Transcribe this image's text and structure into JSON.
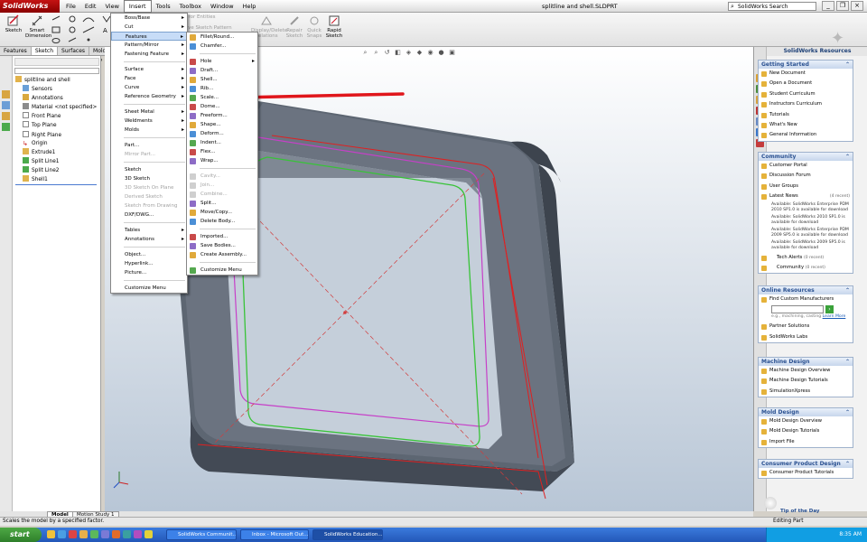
{
  "app": {
    "logo": "SolidWorks",
    "doc_title": "splitline and shell.SLDPRT",
    "search_placeholder": "SolidWorks Search"
  },
  "menubar": {
    "items": [
      "File",
      "Edit",
      "View",
      "Insert",
      "Tools",
      "Toolbox",
      "Window",
      "Help"
    ]
  },
  "command_manager": {
    "sketch": "Sketch",
    "smart_dimension": "Smart\nDimension",
    "mirror_entities": "Mirror Entities",
    "move_entities": "Move Sketch Pattern",
    "display_delete": "Display/Delete\nRelations",
    "repair_sketch": "Repair\nSketch",
    "quick_snaps": "Quick\nSnaps",
    "rapid_sketch": "Rapid\nSketch"
  },
  "left_tabs": [
    "Features",
    "Sketch",
    "Surfaces",
    "Mold Too"
  ],
  "tree": {
    "root": "splitline and shell",
    "items": [
      "Sensors",
      "Annotations",
      "Material <not specified>",
      "Front Plane",
      "Top Plane",
      "Right Plane",
      "Origin",
      "Extrude1",
      "Split Line1",
      "Split Line2",
      "Shell1"
    ]
  },
  "insert_menu": {
    "items": [
      {
        "label": "Boss/Base",
        "sub": true
      },
      {
        "label": "Cut",
        "sub": true
      },
      {
        "label": "Features",
        "sub": true,
        "hi": true
      },
      {
        "label": "Pattern/Mirror",
        "sub": true
      },
      {
        "label": "Fastening Feature",
        "sub": true
      },
      {
        "sep": true
      },
      {
        "label": "Surface",
        "sub": true
      },
      {
        "label": "Face",
        "sub": true
      },
      {
        "label": "Curve",
        "sub": true
      },
      {
        "label": "Reference Geometry",
        "sub": true
      },
      {
        "sep": true
      },
      {
        "label": "Sheet Metal",
        "sub": true
      },
      {
        "label": "Weldments",
        "sub": true
      },
      {
        "label": "Molds",
        "sub": true
      },
      {
        "sep": true
      },
      {
        "label": "Part..."
      },
      {
        "label": "Mirror Part...",
        "dis": true
      },
      {
        "sep": true
      },
      {
        "label": "Sketch"
      },
      {
        "label": "3D Sketch"
      },
      {
        "label": "3D Sketch On Plane",
        "dis": true
      },
      {
        "label": "Derived Sketch",
        "dis": true
      },
      {
        "label": "Sketch From Drawing",
        "dis": true
      },
      {
        "label": "DXF/DWG..."
      },
      {
        "sep": true
      },
      {
        "label": "Tables",
        "sub": true
      },
      {
        "label": "Annotations",
        "sub": true
      },
      {
        "sep": true
      },
      {
        "label": "Object..."
      },
      {
        "label": "Hyperlink..."
      },
      {
        "label": "Picture..."
      },
      {
        "sep": true
      },
      {
        "label": "Customize Menu"
      }
    ]
  },
  "features_menu": {
    "items": [
      {
        "label": "Fillet/Round..."
      },
      {
        "label": "Chamfer..."
      },
      {
        "sep": true
      },
      {
        "label": "Hole",
        "sub": true
      },
      {
        "label": "Draft..."
      },
      {
        "label": "Shell..."
      },
      {
        "label": "Rib..."
      },
      {
        "label": "Scale..."
      },
      {
        "label": "Dome..."
      },
      {
        "label": "Freeform..."
      },
      {
        "label": "Shape..."
      },
      {
        "label": "Deform..."
      },
      {
        "label": "Indent..."
      },
      {
        "label": "Flex..."
      },
      {
        "label": "Wrap..."
      },
      {
        "sep": true
      },
      {
        "label": "Cavity...",
        "dis": true
      },
      {
        "label": "Join...",
        "dis": true
      },
      {
        "label": "Combine...",
        "dis": true
      },
      {
        "label": "Split..."
      },
      {
        "label": "Move/Copy..."
      },
      {
        "label": "Delete Body..."
      },
      {
        "sep": true
      },
      {
        "label": "Imported..."
      },
      {
        "label": "Save Bodies..."
      },
      {
        "label": "Create Assembly..."
      },
      {
        "sep": true
      },
      {
        "label": "Customize Menu"
      }
    ]
  },
  "task_pane": {
    "header": "SolidWorks Resources",
    "getting_started": {
      "title": "Getting Started",
      "items": [
        "New Document",
        "Open a Document",
        "Student Curriculum",
        "Instructors Curriculum",
        "Tutorials",
        "What's New",
        "General Information"
      ]
    },
    "community": {
      "title": "Community",
      "items": [
        "Customer Portal",
        "Discussion Forum",
        "User Groups"
      ],
      "latest_news": "Latest News",
      "latest_news_count": "(4 recent)",
      "news": [
        "Available: SolidWorks Enterprise PDM 2010 SP1.0 is available for download",
        "Available: SolidWorks 2010 SP1.0 is available for download",
        "Available: SolidWorks Enterprise PDM 2009 SP5.0 is available for download",
        "Available: SolidWorks 2009 SP5.0 is available for download"
      ],
      "tech_alerts": "Tech Alerts",
      "tech_alerts_count": "(0 recent)",
      "community_item": "Community",
      "community_count": "(0 recent)"
    },
    "online_resources": {
      "title": "Online Resources",
      "find": "Find Custom Manufacturers",
      "hint": "e.g., machining, casting",
      "learn_more": "Learn More",
      "items": [
        "Partner Solutions",
        "SolidWorks Labs"
      ]
    },
    "machine_design": {
      "title": "Machine Design",
      "items": [
        "Machine Design Overview",
        "Machine Design Tutorials",
        "SimulationXpress"
      ]
    },
    "mold_design": {
      "title": "Mold Design",
      "items": [
        "Mold Design Overview",
        "Mold Design Tutorials",
        "Import File"
      ]
    },
    "consumer": {
      "title": "Consumer Product Design",
      "items": [
        "Consumer Product Tutorials"
      ]
    },
    "tip": "Tip of the Day"
  },
  "model_tabs": [
    "Model",
    "Motion Study 1"
  ],
  "status": {
    "text": "Scales the model by a specified factor.",
    "right": "Editing Part"
  },
  "taskbar": {
    "start": "start",
    "windows": [
      "SolidWorks Communit...",
      "Inbox - Microsoft Out...",
      "SolidWorks Education..."
    ],
    "clock": "8:35 AM"
  },
  "colors": {
    "accent_arrow": "#e0161b",
    "highlight": "#c7dcf7",
    "sw_red": "#b40e0e"
  }
}
